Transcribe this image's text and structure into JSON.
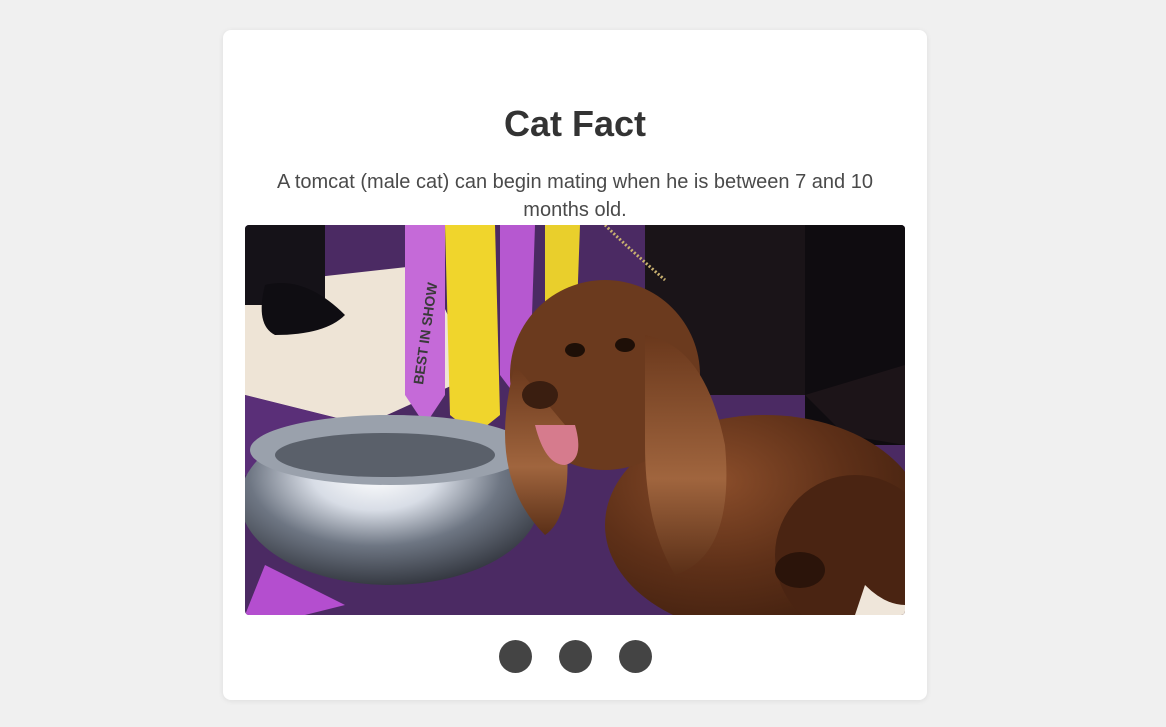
{
  "card": {
    "title": "Cat Fact",
    "fact": "A tomcat (male cat) can begin mating when he is between 7 and 10 months old."
  },
  "photo": {
    "subject": "dog-with-trophy",
    "ribbon_text": "BEST IN SHOW"
  },
  "controls": {
    "dots": [
      {
        "color": "#444444"
      },
      {
        "color": "#444444"
      },
      {
        "color": "#444444"
      }
    ]
  },
  "colors": {
    "background": "#f0f0f0",
    "card": "#ffffff",
    "title": "#333333",
    "text": "#4a4a4a",
    "dot": "#444444"
  }
}
